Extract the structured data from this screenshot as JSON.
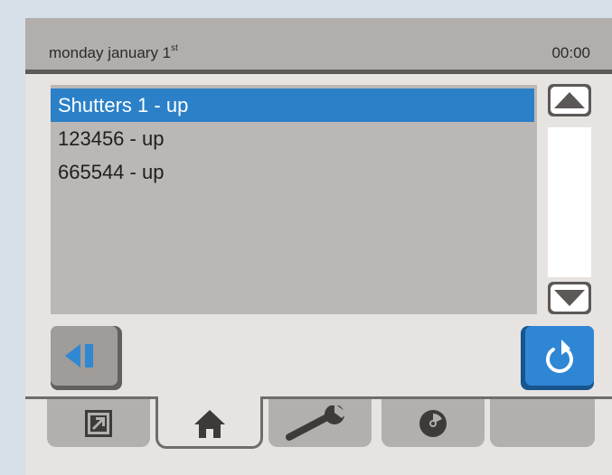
{
  "header": {
    "date_main": "monday january 1",
    "date_suffix": "st",
    "time": "00:00"
  },
  "list": {
    "items": [
      {
        "label": "Shutters 1 - up",
        "selected": true
      },
      {
        "label": "123456 - up",
        "selected": false
      },
      {
        "label": "665544 - up",
        "selected": false
      }
    ]
  },
  "colors": {
    "accent": "#2b80c8",
    "header_bg": "#b2aeac",
    "list_bg": "#bbb7b5",
    "page_bg": "#e7e3e1"
  },
  "icons": {
    "scroll_up": "triangle-up-icon",
    "scroll_down": "triangle-down-icon",
    "back": "back-icon",
    "refresh": "refresh-icon",
    "tab_1": "open-arrow-icon",
    "tab_2": "home-icon",
    "tab_3": "wrench-icon",
    "tab_4": "disc-icon"
  }
}
